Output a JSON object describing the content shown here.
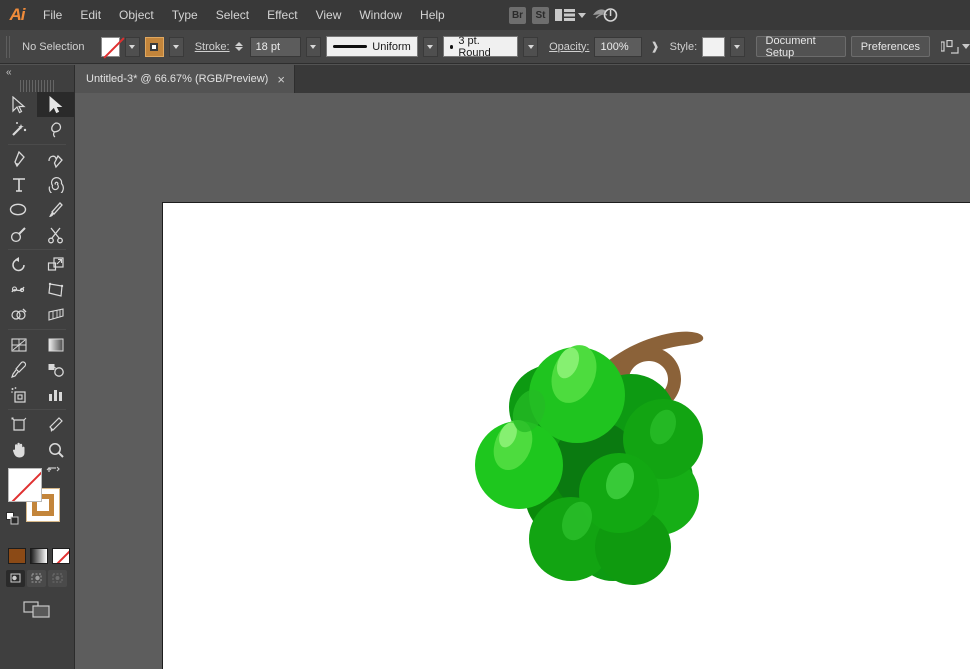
{
  "app": {
    "name": "Adobe Illustrator",
    "logo_text": "Ai"
  },
  "menubar": {
    "items": [
      {
        "label": "File"
      },
      {
        "label": "Edit"
      },
      {
        "label": "Object"
      },
      {
        "label": "Type"
      },
      {
        "label": "Select"
      },
      {
        "label": "Effect"
      },
      {
        "label": "View"
      },
      {
        "label": "Window"
      },
      {
        "label": "Help"
      }
    ],
    "right_buttons": [
      {
        "label": "Br",
        "name": "bridge-button"
      },
      {
        "label": "St",
        "name": "stock-button"
      }
    ],
    "arrange_icon": "arrange-documents-icon",
    "power_icon": "power-icon"
  },
  "controlbar": {
    "selection_status": "No Selection",
    "fill_swatch": "none",
    "stroke_swatch": "orange",
    "stroke_label": "Stroke:",
    "stroke_weight": "18 pt",
    "profile_label": "Uniform",
    "brush_label": "3 pt. Round",
    "opacity_label": "Opacity:",
    "opacity_value": "100%",
    "style_label": "Style:",
    "document_setup_label": "Document Setup",
    "preferences_label": "Preferences"
  },
  "tabs": [
    {
      "title": "Untitled-3* @ 66.67% (RGB/Preview)",
      "close": "×",
      "active": true
    }
  ],
  "tools": {
    "collapse_glyph": "«",
    "items": [
      {
        "name": "selection-tool",
        "active": false
      },
      {
        "name": "direct-selection-tool",
        "active": true
      },
      {
        "name": "magic-wand-tool",
        "active": false
      },
      {
        "name": "lasso-tool",
        "active": false
      },
      {
        "name": "pen-tool",
        "active": false
      },
      {
        "name": "curvature-tool",
        "active": false
      },
      {
        "name": "type-tool",
        "active": false
      },
      {
        "name": "line-segment-tool",
        "active": false
      },
      {
        "name": "ellipse-tool",
        "active": false
      },
      {
        "name": "paintbrush-tool",
        "active": false
      },
      {
        "name": "shaper-tool",
        "active": false
      },
      {
        "name": "scissors-tool",
        "active": false
      },
      {
        "name": "rotate-tool",
        "active": false
      },
      {
        "name": "scale-tool",
        "active": false
      },
      {
        "name": "width-tool",
        "active": false
      },
      {
        "name": "free-transform-tool",
        "active": false
      },
      {
        "name": "shape-builder-tool",
        "active": false
      },
      {
        "name": "perspective-grid-tool",
        "active": false
      },
      {
        "name": "mesh-tool",
        "active": false
      },
      {
        "name": "gradient-tool",
        "active": false
      },
      {
        "name": "eyedropper-tool",
        "active": false
      },
      {
        "name": "blend-tool",
        "active": false
      },
      {
        "name": "symbol-sprayer-tool",
        "active": false
      },
      {
        "name": "column-graph-tool",
        "active": false
      },
      {
        "name": "artboard-tool",
        "active": false
      },
      {
        "name": "slice-tool",
        "active": false
      },
      {
        "name": "hand-tool",
        "active": false
      },
      {
        "name": "zoom-tool",
        "active": false
      }
    ],
    "color_controls": {
      "fill": "none",
      "stroke": "#c3853b",
      "mini_swatches": [
        "color",
        "gradient",
        "none"
      ],
      "draw_modes": [
        "draw-normal",
        "draw-behind",
        "draw-inside"
      ],
      "active_draw_mode": "draw-normal",
      "screen_mode": "change-screen-mode"
    }
  },
  "artwork": {
    "name": "green-grapes-illustration",
    "colors": {
      "grape_light": "#22c522",
      "grape_mid": "#18b018",
      "grape_dark": "#0d9a12",
      "grape_darker": "#0a8a0a",
      "grape_shadow": "#0f7a12",
      "highlight": "#55e24a",
      "highlight_strong": "#7df06a",
      "stem": "#8b6239"
    }
  },
  "colors": {
    "menubar_bg": "#393939",
    "controlbar_bg": "#454545",
    "panel_bg": "#3f3f3f",
    "canvas_bg": "#5d5d5d",
    "artboard_bg": "#ffffff",
    "accent": "#f08b3a"
  }
}
